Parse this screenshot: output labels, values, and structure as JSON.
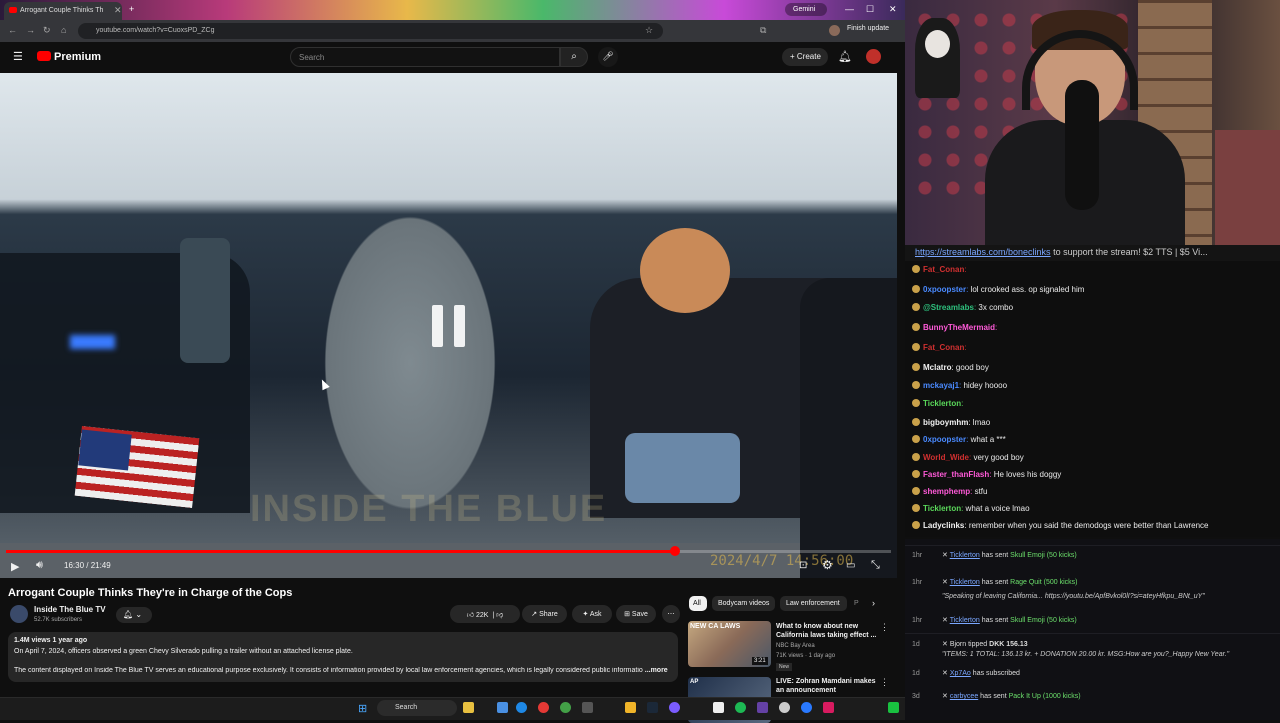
{
  "browser": {
    "tab_title": "Arrogant Couple Thinks Th",
    "url": "youtube.com/watch?v=CuoxsPD_ZCg",
    "gemini_label": "Gemini",
    "finish_update_label": "Finish update"
  },
  "youtube_header": {
    "logo_text": "Premium",
    "search_placeholder": "Search",
    "create_label": "Create"
  },
  "player": {
    "time": "16:30 / 21:49",
    "progress_fraction": 0.756,
    "watermark": "INSIDE THE BLUE",
    "overlay_date": "2024/4/7 14:56:00"
  },
  "video": {
    "title": "Arrogant Couple Thinks They're in Charge of the Cops",
    "channel": "Inside The Blue TV",
    "subscribers": "52.7K subscribers",
    "likes": "22K",
    "share_label": "Share",
    "ask_label": "Ask",
    "save_label": "Save",
    "stats": "1.4M views  1 year ago",
    "desc_line1": "On April 7, 2024, officers observed a green Chevy Silverado pulling a trailer without an attached license plate.",
    "desc_line2": "The content displayed on Inside The Blue TV serves an educational purpose exclusively. It consists of information provided by local law enforcement agencies, which is legally considered public informatio",
    "more_label": "...more"
  },
  "recommend": {
    "chips": [
      "All",
      "Bodycam videos",
      "Law enforcement",
      "P"
    ],
    "items": [
      {
        "thumb_text": "NEW CA LAWS",
        "title": "What to know about new California laws taking effect ...",
        "channel": "NBC Bay Area",
        "meta": "71K views · 1 day ago",
        "badge": "New",
        "duration": "3:21"
      },
      {
        "thumb_text": "AP",
        "title": "LIVE: Zohran Mamdani makes an announcement",
        "channel": "",
        "meta": "",
        "badge": "",
        "duration": ""
      }
    ]
  },
  "stream": {
    "ticker_link": "https://streamlabs.com/boneclinks",
    "ticker_rest": " to support the stream! $2 TTS | $5 Vi...",
    "chat": [
      {
        "user": "Fat_Conan",
        "color": "#d03030",
        "text": ""
      },
      {
        "user": "0xpoopster",
        "color": "#4a8aff",
        "text": "lol crooked ass. op signaled him"
      },
      {
        "user": "@Streamlabs",
        "color": "#2ec27e",
        "text": "3x  combo"
      },
      {
        "user": "BunnyTheMermaid",
        "color": "#ff5ad8",
        "text": ""
      },
      {
        "user": "Fat_Conan",
        "color": "#d03030",
        "text": ""
      },
      {
        "user": "Mclatro",
        "color": "#f2f2f2",
        "text": "good boy"
      },
      {
        "user": "mckayaj1",
        "color": "#4a8aff",
        "text": "hidey hoooo"
      },
      {
        "user": "Ticklerton",
        "color": "#5ad85a",
        "text": ""
      },
      {
        "user": "bigboymhm",
        "color": "#f2f2f2",
        "text": "lmao"
      },
      {
        "user": "0xpoopster",
        "color": "#4a8aff",
        "text": "what a ***"
      },
      {
        "user": "World_Wide",
        "color": "#d03030",
        "text": "very good boy"
      },
      {
        "user": "Faster_thanFlash",
        "color": "#ff5ad8",
        "text": "He loves his doggy"
      },
      {
        "user": "shemphemp",
        "color": "#ff5ad8",
        "text": "stfu"
      },
      {
        "user": "Ticklerton",
        "color": "#5ad85a",
        "text": "what a voice lmao"
      },
      {
        "user": "Ladyclinks",
        "color": "#f2f2f2",
        "text": "remember when you said the demodogs were better than Lawrence"
      }
    ],
    "alerts": [
      {
        "time": "1hr",
        "name": "Ticklerton",
        "verb": "has sent",
        "item": "Skull Emoji (50 kicks)",
        "sub": ""
      },
      {
        "time": "1hr",
        "name": "Ticklerton",
        "verb": "has sent",
        "item": "Rage Quit (500 kicks)",
        "sub": "\"Speaking of leaving California... https://youtu.be/ApfBvkol0lI?si=ateyHfkpu_BNt_uY\""
      },
      {
        "time": "1hr",
        "name": "Ticklerton",
        "verb": "has sent",
        "item": "Skull Emoji (50 kicks)",
        "sub": ""
      },
      {
        "time": "1d",
        "name": "Bjorn",
        "verb": "tipped",
        "item": "DKK 156.13",
        "sub": "\"ITEMS: 1 TOTAL: 136.13 kr. + DONATION 20.00 kr. MSG:How are you?_Happy New Year.\""
      },
      {
        "time": "1d",
        "name": "Xp7Ao",
        "verb": "has subscribed",
        "item": "",
        "sub": ""
      },
      {
        "time": "3d",
        "name": "carbycee",
        "verb": "has sent",
        "item": "Pack It Up (1000 kicks)",
        "sub": ""
      }
    ]
  },
  "taskbar": {
    "search_label": "Search"
  }
}
